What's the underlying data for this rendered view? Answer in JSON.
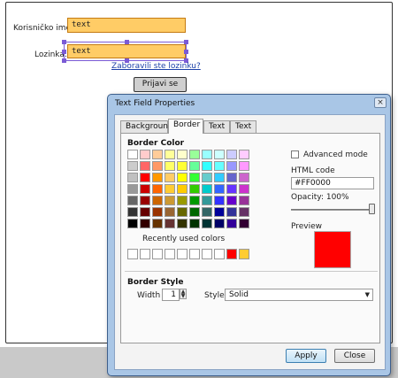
{
  "mockup": {
    "username_label": "Korisničko ime:",
    "username_value": "text",
    "password_label": "Lozinka:",
    "password_value": "text",
    "forgot_link": "Zaboravili ste lozinku?",
    "login_button": "Prijavi se"
  },
  "dialog": {
    "title": "Text Field Properties",
    "close_glyph": "×",
    "tabs": [
      {
        "label": "Background",
        "active": false
      },
      {
        "label": "Border",
        "active": true
      },
      {
        "label": "Text",
        "active": false
      },
      {
        "label": "Text",
        "active": false
      }
    ],
    "border_color": {
      "section_title": "Border Color",
      "swatch_rows": [
        [
          "#ffffff",
          "#ffcccc",
          "#ffcc99",
          "#ffff99",
          "#ffffcc",
          "#99ff99",
          "#99ffff",
          "#ccffff",
          "#ccccff",
          "#ffccff"
        ],
        [
          "#cccccc",
          "#ff6666",
          "#ff9966",
          "#ffff66",
          "#ffff33",
          "#66ff99",
          "#33ffff",
          "#66ffff",
          "#9999ff",
          "#ff99ff"
        ],
        [
          "#c0c0c0",
          "#ff0000",
          "#ff9900",
          "#ffcc66",
          "#ffff00",
          "#33ff33",
          "#66cccc",
          "#33ccff",
          "#6666cc",
          "#cc66cc"
        ],
        [
          "#999999",
          "#cc0000",
          "#ff6600",
          "#ffcc33",
          "#ffcc00",
          "#33cc00",
          "#00cccc",
          "#3366ff",
          "#6633ff",
          "#cc33cc"
        ],
        [
          "#666666",
          "#990000",
          "#cc6600",
          "#cc9933",
          "#999900",
          "#009900",
          "#339999",
          "#3333ff",
          "#6600cc",
          "#993399"
        ],
        [
          "#333333",
          "#660000",
          "#993300",
          "#996633",
          "#666600",
          "#006600",
          "#336666",
          "#000099",
          "#333399",
          "#663366"
        ],
        [
          "#000000",
          "#330000",
          "#663300",
          "#663333",
          "#333300",
          "#003300",
          "#003333",
          "#000066",
          "#330099",
          "#330033"
        ]
      ],
      "recent_label": "Recently used colors",
      "recent_colors": [
        "#ffffff",
        "#ffffff",
        "#ffffff",
        "#ffffff",
        "#ffffff",
        "#ffffff",
        "#ffffff",
        "#ffffff",
        "#ff0000",
        "#ffcc33"
      ],
      "advanced_mode_label": "Advanced mode",
      "advanced_mode_checked": false,
      "html_code_label": "HTML code",
      "html_code_value": "#FF0000",
      "opacity_label": "Opacity: 100%",
      "opacity": 1.0,
      "preview_label": "Preview",
      "preview_color": "#ff0000"
    },
    "border_style": {
      "section_title": "Border Style",
      "width_label": "Width",
      "width_value": "1",
      "style_label": "Style",
      "style_value": "Solid"
    },
    "apply_label": "Apply",
    "close_label": "Close"
  },
  "colors": {
    "textfield_fill": "#ffcc66",
    "selection": "#7b5bd6",
    "link": "#1a3fa8",
    "dialog_frame": "#a9c6e6"
  }
}
